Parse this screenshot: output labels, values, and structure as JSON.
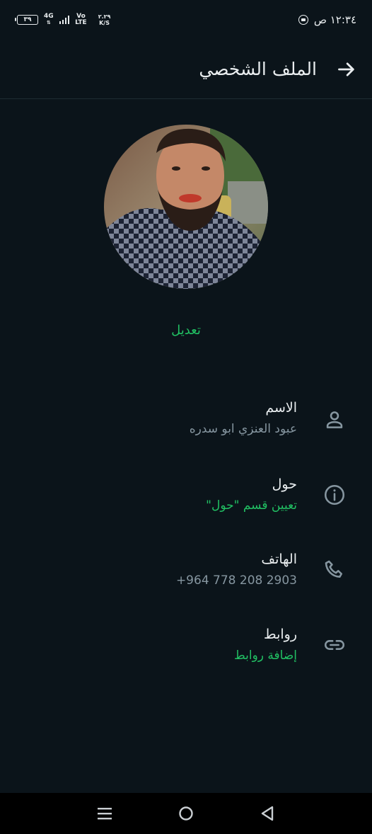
{
  "status_bar": {
    "battery": "٣٩",
    "network": "4G",
    "volte_top": "Vo",
    "volte_bottom": "LTE",
    "speed_top": "٢.٢٩",
    "speed_bottom": "K/S",
    "time": "١٢:٣٤ ص"
  },
  "header": {
    "title": "الملف الشخصي",
    "back_icon": "arrow-right-icon"
  },
  "profile": {
    "avatar_icon": "profile-photo",
    "edit_label": "تعديل"
  },
  "rows": [
    {
      "label": "الاسم",
      "value": "عبود العنزي ابو سدره",
      "icon": "person-icon"
    },
    {
      "label": "حول",
      "value": "تعيين قسم \"حول\"",
      "icon": "info-icon"
    },
    {
      "label": "الهاتف",
      "value": "+964 778 208 2903",
      "icon": "phone-icon"
    },
    {
      "label": "روابط",
      "value": "إضافة روابط",
      "icon": "link-icon"
    }
  ],
  "colors": {
    "background": "#0b141a",
    "accent": "#21c063",
    "secondary_text": "#8696a0"
  },
  "nav_bar": {
    "items": [
      "menu-icon",
      "home-circle-icon",
      "back-triangle-icon"
    ]
  }
}
